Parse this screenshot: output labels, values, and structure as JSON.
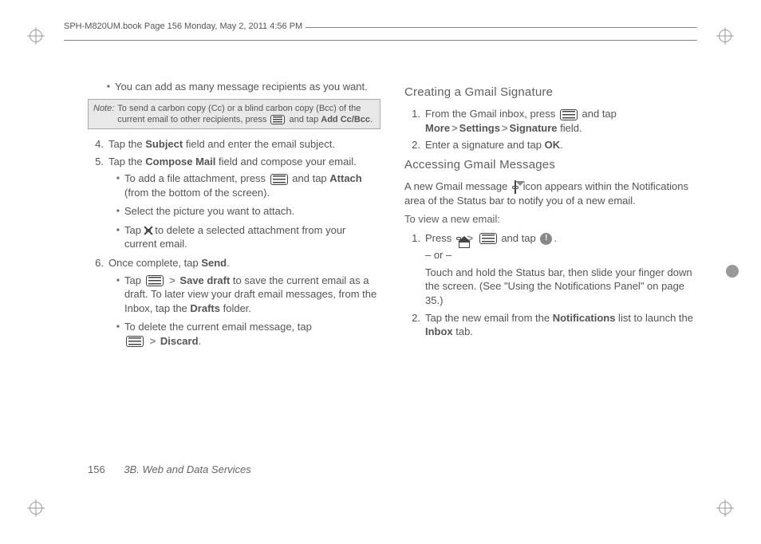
{
  "header": {
    "text": "SPH-M820UM.book  Page 156  Monday, May 2, 2011  4:56 PM"
  },
  "left": {
    "b1": "You can add as many message recipients as you want.",
    "note_label": "Note:",
    "note_body_a": "To send a carbon copy (Cc) or a blind carbon copy (Bcc) of the current email to other recipients, press ",
    "note_body_b": " and tap ",
    "note_bold": "Add Cc/Bcc",
    "note_body_c": ".",
    "s4a": "Tap the ",
    "s4b": "Subject",
    "s4c": " field and enter the email subject.",
    "s5a": "Tap the ",
    "s5b": "Compose Mail",
    "s5c": " field and compose your email.",
    "s5_1a": "To add a file attachment, press ",
    "s5_1b": " and tap ",
    "s5_1c": "Attach",
    "s5_1d": " (from the bottom of the screen).",
    "s5_2": "Select the picture you want to attach.",
    "s5_3a": "Tap ",
    "s5_3b": " to delete a selected attachment from your current email.",
    "s6a": "Once complete, tap ",
    "s6b": "Send",
    "s6c": ".",
    "s6_1a": "Tap ",
    "s6_1b": "Save draft",
    "s6_1c": " to save the current email as a draft. To later view your draft email messages, from the Inbox, tap the ",
    "s6_1d": "Drafts",
    "s6_1e": " folder.",
    "s6_2a": "To delete the current email message, tap ",
    "s6_2b": "Discard",
    "s6_2c": "."
  },
  "right": {
    "h1": "Creating a Gmail Signature",
    "r1a": "From the Gmail inbox, press ",
    "r1b": " and tap ",
    "r1c": "More",
    "r1d": "Settings",
    "r1e": "Signature",
    "r1f": " field.",
    "r2a": "Enter a signature and tap ",
    "r2b": "OK",
    "r2c": ".",
    "h2": "Accessing Gmail Messages",
    "p1a": "A new Gmail message ",
    "p1b": " icon appears within the Notifications area of the Status bar to notify you of a new email.",
    "sub1": "To view a new email:",
    "v1a": "Press ",
    "v1b": " and tap ",
    "v1c": ".",
    "or": "– or –",
    "v1d": "Touch and hold the Status bar, then slide your finger down the screen. (See \"Using the Notifications Panel\" on page 35.)",
    "v2a": "Tap the new email from the ",
    "v2b": "Notifications",
    "v2c": " list to launch the ",
    "v2d": "Inbox",
    "v2e": " tab."
  },
  "footer": {
    "page": "156",
    "section": "3B. Web and Data Services"
  }
}
